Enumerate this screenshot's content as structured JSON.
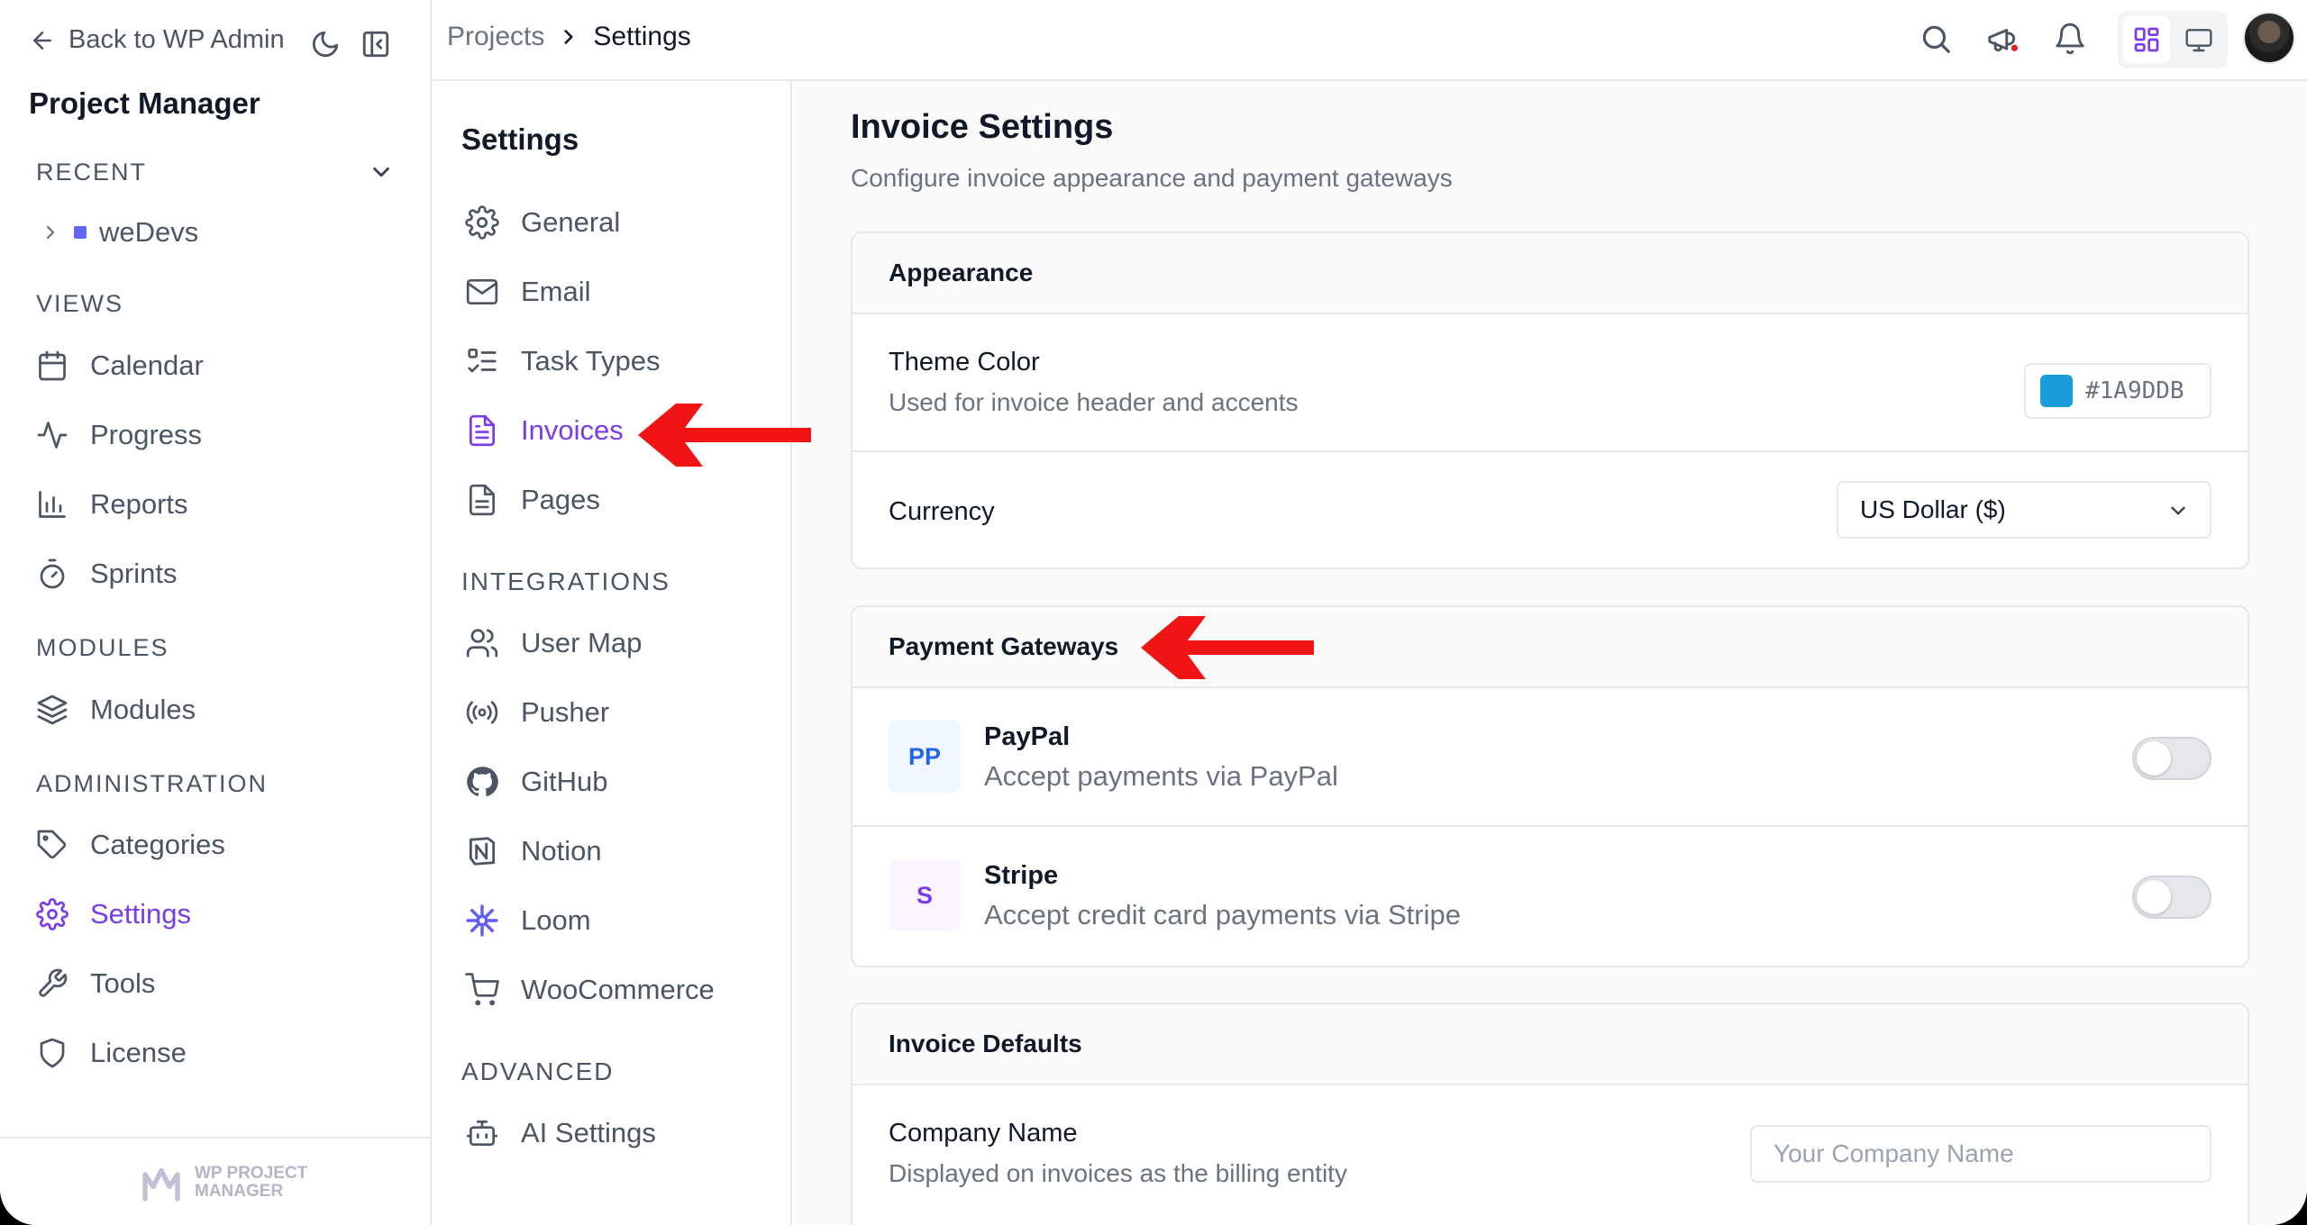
{
  "sidebar": {
    "back_label": "Back to WP Admin",
    "app_title": "Project Manager",
    "recent_label": "RECENT",
    "recent_item": "weDevs",
    "views_label": "VIEWS",
    "views": [
      {
        "label": "Calendar",
        "icon": "calendar-icon"
      },
      {
        "label": "Progress",
        "icon": "activity-icon"
      },
      {
        "label": "Reports",
        "icon": "bar-chart-icon"
      },
      {
        "label": "Sprints",
        "icon": "timer-icon"
      }
    ],
    "modules_label": "MODULES",
    "modules_item": "Modules",
    "admin_label": "ADMINISTRATION",
    "admin_items": [
      {
        "label": "Categories",
        "icon": "tag-icon"
      },
      {
        "label": "Settings",
        "icon": "gear-icon",
        "active": true
      },
      {
        "label": "Tools",
        "icon": "wrench-icon"
      },
      {
        "label": "License",
        "icon": "shield-icon"
      }
    ],
    "footer_logo_line1": "WP PROJECT",
    "footer_logo_line2": "MANAGER"
  },
  "topbar": {
    "breadcrumb_parent": "Projects",
    "breadcrumb_current": "Settings"
  },
  "subnav": {
    "title": "Settings",
    "items": [
      "General",
      "Email",
      "Task Types",
      "Invoices",
      "Pages"
    ],
    "active": "Invoices",
    "integrations_label": "INTEGRATIONS",
    "integrations": [
      "User Map",
      "Pusher",
      "GitHub",
      "Notion",
      "Loom",
      "WooCommerce"
    ],
    "advanced_label": "ADVANCED",
    "advanced": [
      "AI Settings"
    ]
  },
  "main": {
    "title": "Invoice Settings",
    "subtitle": "Configure invoice appearance and payment gateways",
    "appearance": {
      "header": "Appearance",
      "theme_color_title": "Theme Color",
      "theme_color_desc": "Used for invoice header and accents",
      "theme_color_value": "#1A9DDB",
      "currency_title": "Currency",
      "currency_value": "US Dollar ($)"
    },
    "gateways": {
      "header": "Payment Gateways",
      "items": [
        {
          "badge": "PP",
          "name": "PayPal",
          "desc": "Accept payments via PayPal",
          "enabled": false,
          "badge_color": "#2563eb",
          "badge_bg": "#eff6ff"
        },
        {
          "badge": "S",
          "name": "Stripe",
          "desc": "Accept credit card payments via Stripe",
          "enabled": false,
          "badge_color": "#7c3aed",
          "badge_bg": "#faf5ff"
        }
      ]
    },
    "defaults": {
      "header": "Invoice Defaults",
      "company_title": "Company Name",
      "company_desc": "Displayed on invoices as the billing entity",
      "company_placeholder": "Your Company Name",
      "company_value": ""
    }
  },
  "colors": {
    "accent": "#7c3aed",
    "annotation_arrow": "#f01414"
  }
}
